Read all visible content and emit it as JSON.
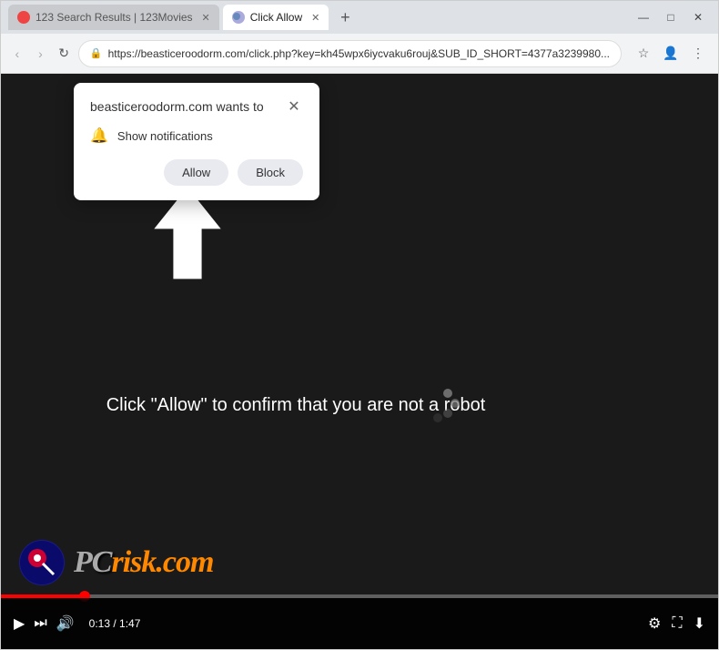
{
  "browser": {
    "tabs": [
      {
        "id": "tab1",
        "label": "123 Search Results | 123Movies",
        "active": false,
        "favicon_color": "#e44444"
      },
      {
        "id": "tab2",
        "label": "Click Allow",
        "active": true,
        "favicon_color": "#8899cc"
      }
    ],
    "new_tab_symbol": "+",
    "window_controls": [
      "—",
      "□",
      "✕"
    ],
    "nav": {
      "back": "‹",
      "forward": "›",
      "refresh": "↻"
    },
    "url": "https://beasticeroodorm.com/click.php?key=kh45wpx6iycvaku6rouj&SUB_ID_SHORT=4377a3239980...",
    "star_icon": "☆",
    "profile_icon": "👤",
    "menu_icon": "⋮"
  },
  "popup": {
    "title": "beasticeroodorm.com wants to",
    "close_symbol": "✕",
    "notification_text": "Show notifications",
    "allow_label": "Allow",
    "block_label": "Block"
  },
  "page": {
    "main_text": "Click \"Allow\" to confirm that you are not a robot",
    "arrow_color": "#ffffff"
  },
  "watermark": {
    "text_part1": "P",
    "text_part2": "C",
    "text_part3": "risk.com"
  },
  "video_controls": {
    "play_symbol": "▶",
    "skip_symbol": "⏭",
    "volume_symbol": "🔊",
    "time_current": "0:13",
    "time_total": "1:47",
    "settings_symbol": "⚙",
    "fullscreen_symbol": "⛶",
    "download_symbol": "⬇",
    "progress_percent": 11.7
  }
}
